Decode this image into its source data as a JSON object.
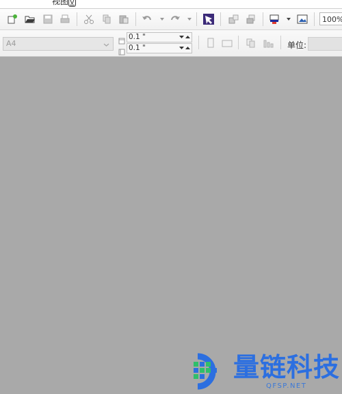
{
  "menu": {
    "view_label": "视图",
    "view_key": "V"
  },
  "toolbar": {
    "zoom_value": "100%",
    "icons": [
      "new-icon",
      "open-icon",
      "save-icon",
      "print-icon",
      "cut-icon",
      "copy-icon",
      "paste-icon",
      "undo-icon",
      "redo-icon",
      "select-tool-icon",
      "send-back-icon",
      "bring-front-icon",
      "fill-icon",
      "image-icon"
    ]
  },
  "page_setup": {
    "paper_size": "A4",
    "margin_top": "0.1 \"",
    "margin_side": "0.1 \"",
    "unit_label": "单位:",
    "unit_value": ""
  },
  "watermark": {
    "title": "量链科技",
    "subtitle": "QFSP.NET",
    "colors": {
      "blue": "#2c6fe0",
      "green": "#2fbf6a"
    }
  }
}
